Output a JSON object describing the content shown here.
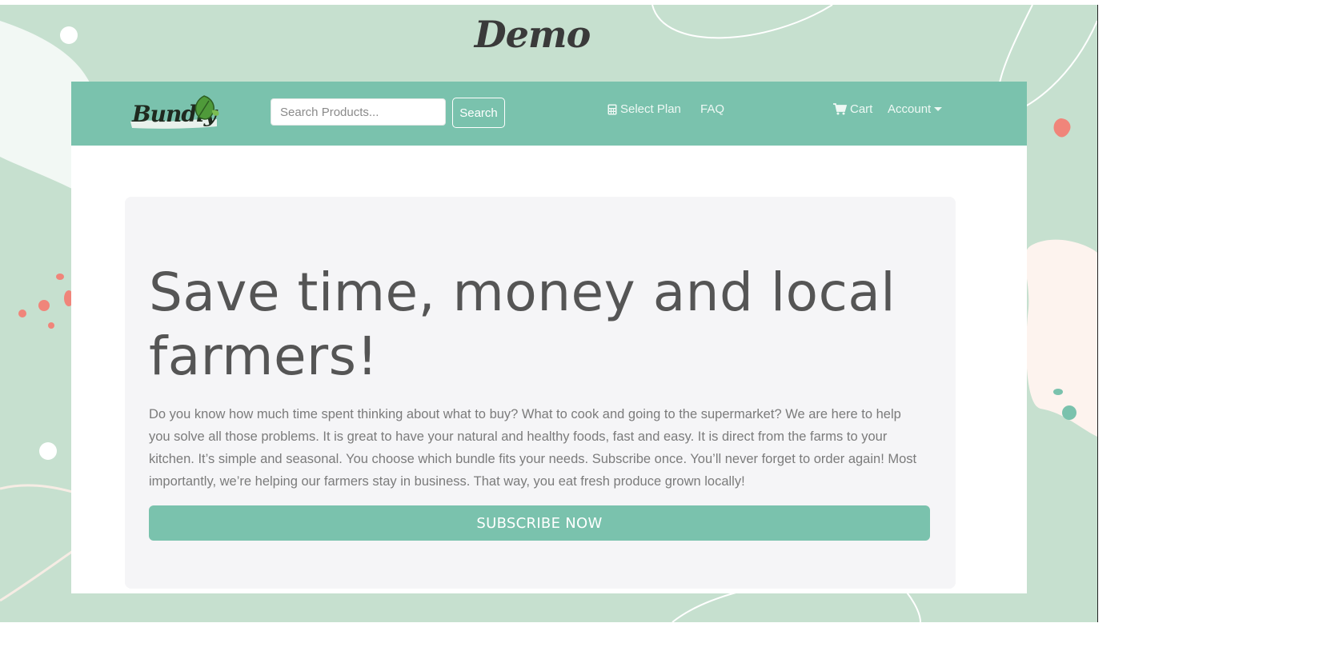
{
  "page_title": "Demo",
  "navbar": {
    "logo_text": "Bundly",
    "search_placeholder": "Search Products...",
    "search_button": "Search",
    "links": {
      "select_plan": "Select Plan",
      "faq": "FAQ",
      "cart": "Cart",
      "account": "Account"
    }
  },
  "hero": {
    "headline": "Save time, money and local farmers!",
    "lead": "Do you know how much time spent thinking about what to buy? What to cook and going to the supermarket? We are here to help you solve all those problems. It is great to have your natural and healthy foods, fast and easy. It is direct from the farms to your kitchen. It’s simple and seasonal. You choose which bundle fits your needs. Subscribe once. You’ll never forget to order again! Most importantly, we’re helping our farmers stay in business. That way, you eat fresh produce grown locally!",
    "cta": "SUBSCRIBE NOW"
  },
  "colors": {
    "background": "#c6e0cf",
    "navbar": "#7ac2ad",
    "jumbotron": "#f5f5f7",
    "accent_coral": "#f0857a",
    "text_dark": "#555555"
  },
  "icons": {
    "select_plan": "calculator-icon",
    "cart": "shopping-cart-icon",
    "account": "caret-down-icon",
    "logo": "leaf-icon"
  }
}
